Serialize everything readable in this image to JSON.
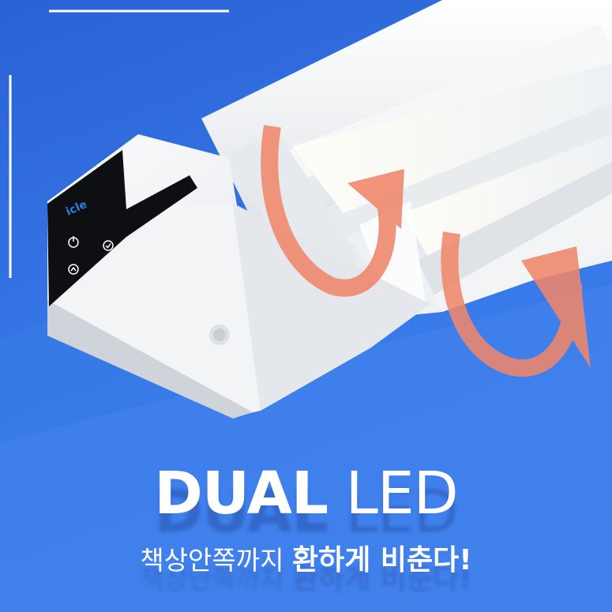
{
  "brand": {
    "logo_text": "icle"
  },
  "headline": {
    "bold": "DUAL",
    "light": "LED"
  },
  "subtitle": {
    "regular": "책상안쪽까지",
    "bold": "환하게 비춘다!"
  },
  "colors": {
    "background": "#3576e6",
    "arrow": "#f08a6e",
    "panel": "#0e0f12",
    "lamp": "#f4f6f8"
  },
  "icons": [
    "power-icon",
    "check-icon",
    "chevron-up-icon",
    "curved-arrow-icon"
  ]
}
